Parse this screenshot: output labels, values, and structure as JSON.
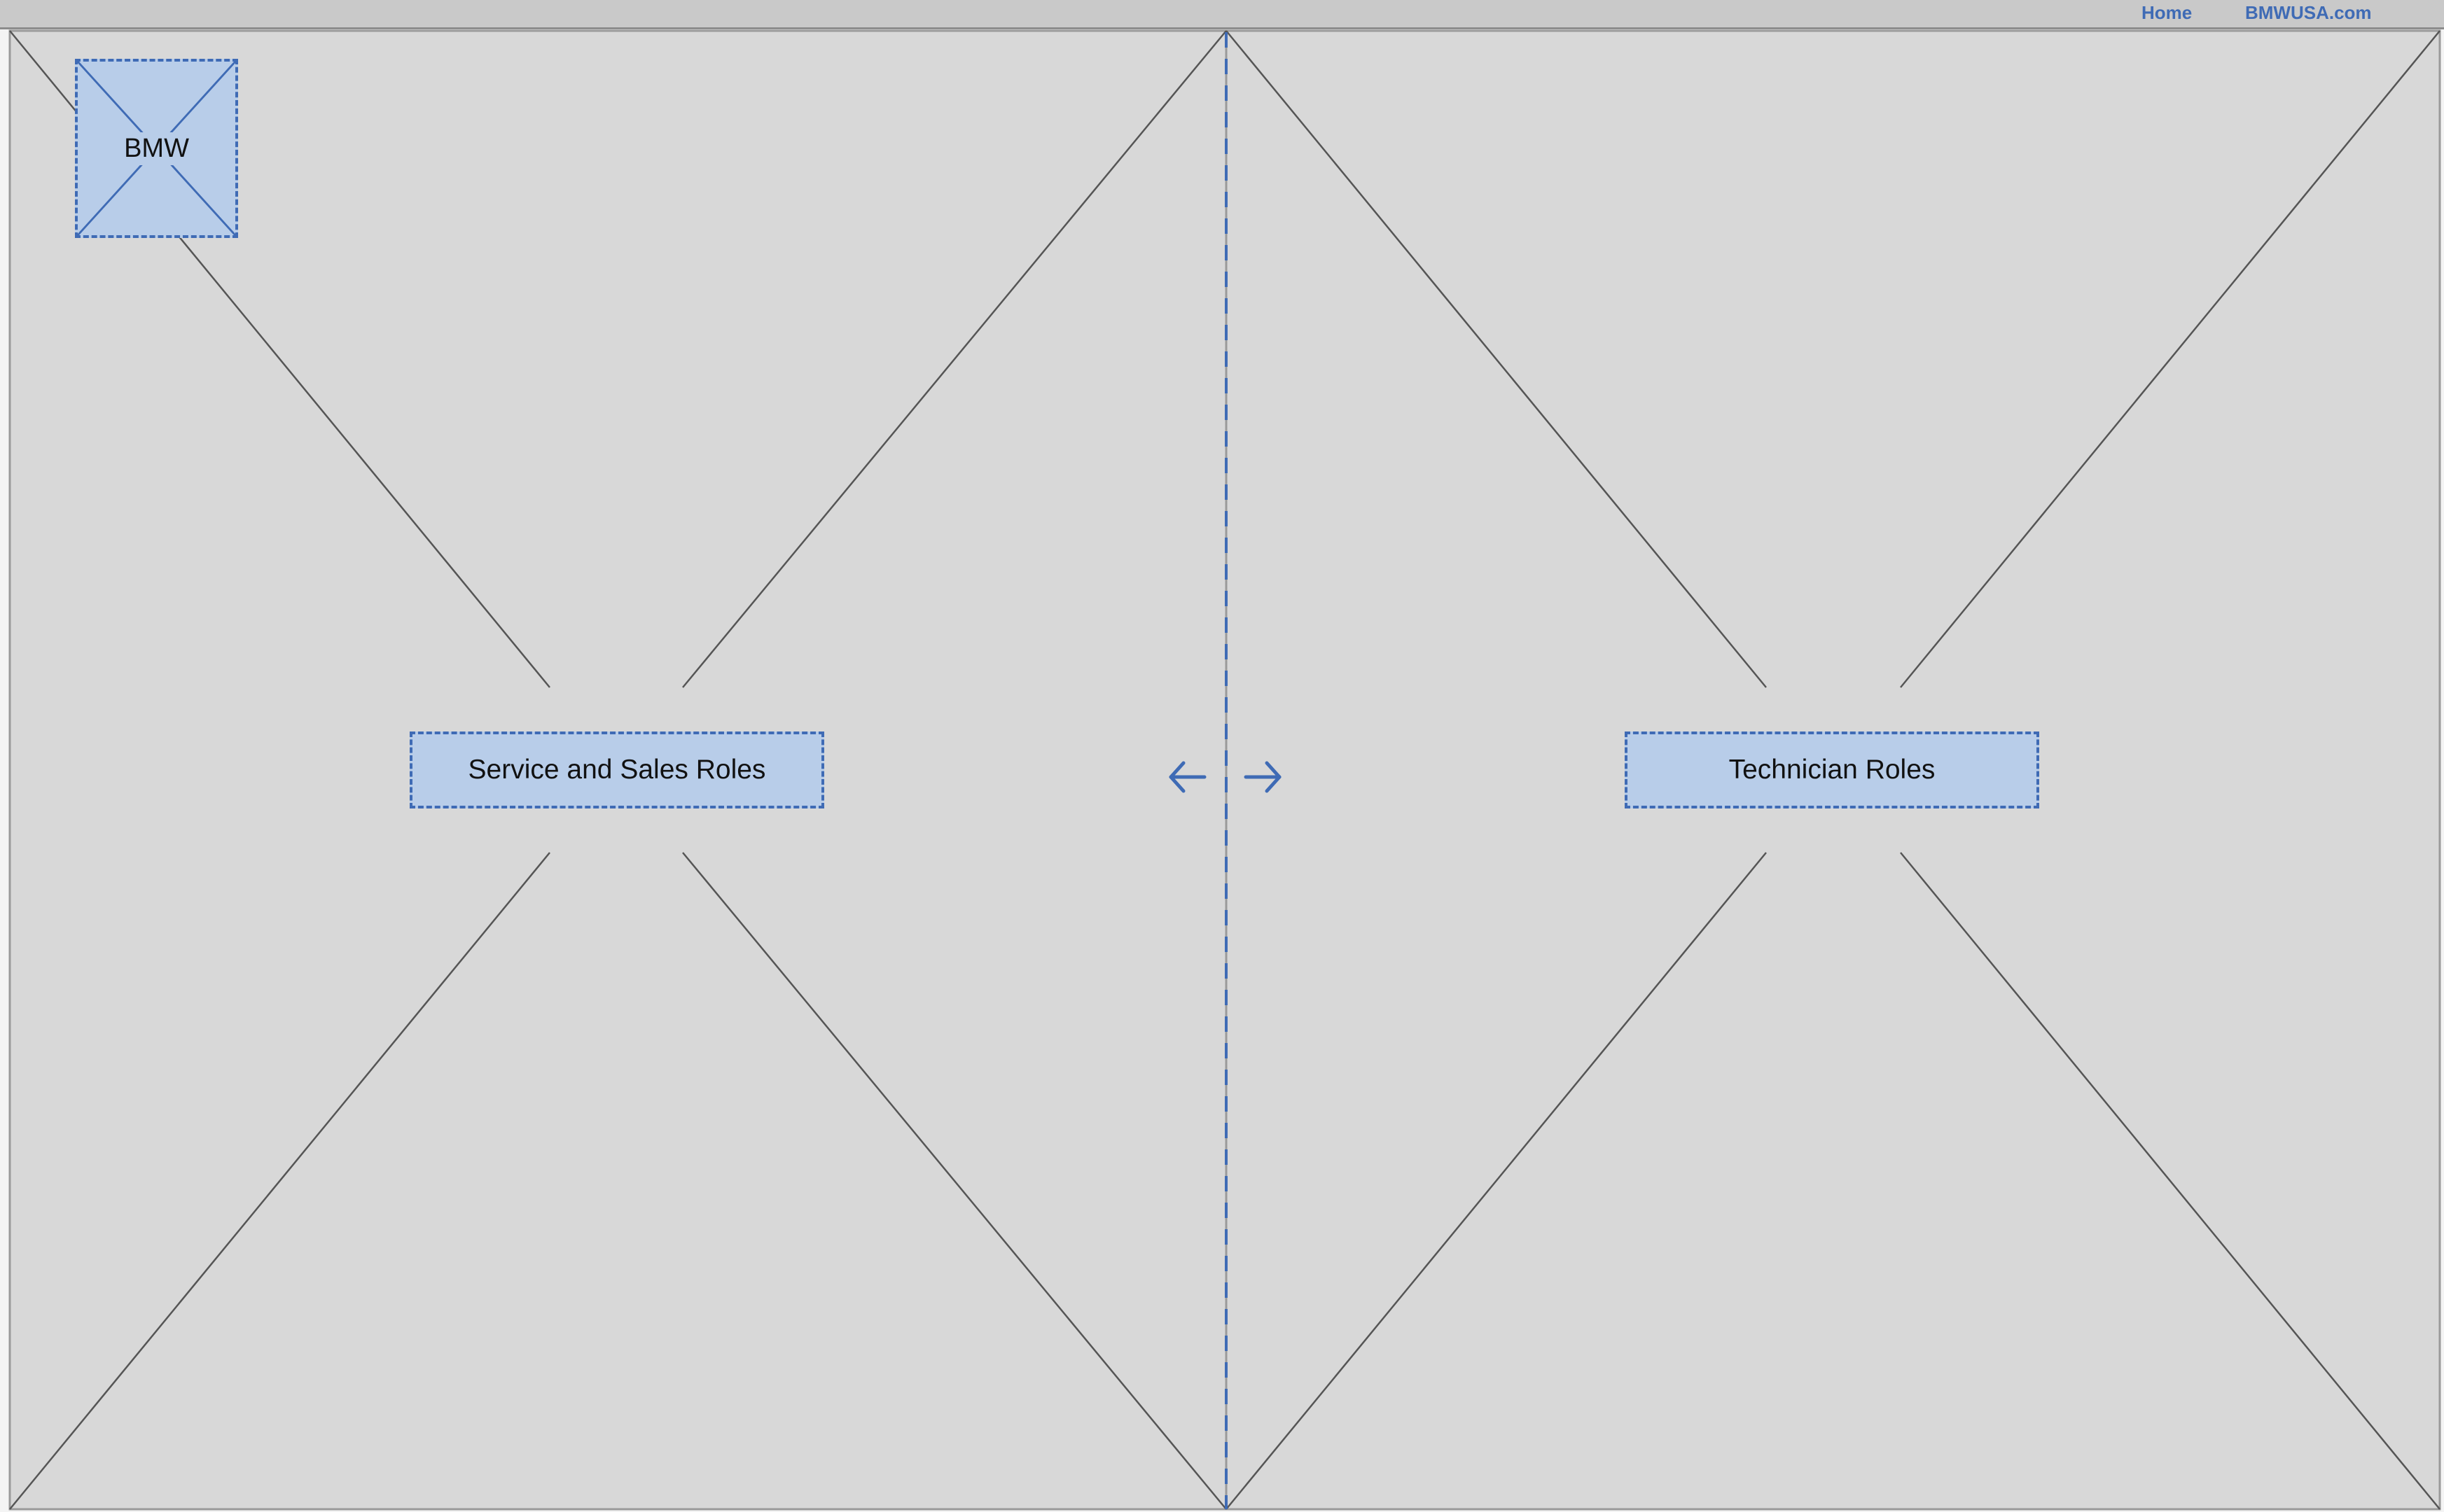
{
  "topbar": {
    "links": [
      {
        "label": "Home"
      },
      {
        "label": "BMWUSA.com"
      }
    ]
  },
  "logo": {
    "label": "BMW"
  },
  "roles": {
    "service_sales_label": "Service and Sales Roles",
    "technician_label": "Technician Roles"
  },
  "split_handle": {
    "left_icon": "arrow-left-icon",
    "right_icon": "arrow-right-icon"
  },
  "colors": {
    "accent": "#3f6bb5",
    "placeholder_fill": "#b8cde9",
    "panel_fill": "#d8d8d8",
    "topbar_fill": "#c9c9c9",
    "wire_line": "#555555"
  }
}
